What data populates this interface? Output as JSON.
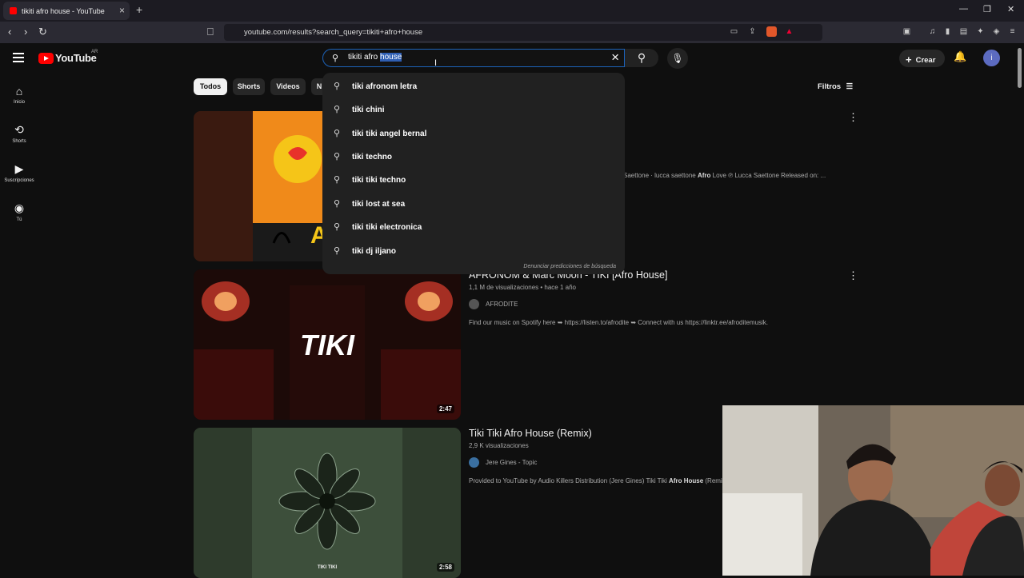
{
  "browser": {
    "tab_title": "tikiti afro house - YouTube",
    "tab_close": "×",
    "new_tab": "+",
    "url": "youtube.com/results?search_query=tikiti+afro+house",
    "win_min": "—",
    "win_max": "❐",
    "win_close": "✕"
  },
  "header": {
    "logo_text": "YouTube",
    "region": "AR",
    "search_query_plain": "tikiti afro ",
    "search_query_selected": "house",
    "create_label": "Crear",
    "avatar_letter": "i"
  },
  "sidebar": {
    "items": [
      {
        "label": "Inicio",
        "icon": "home-icon"
      },
      {
        "label": "Shorts",
        "icon": "shorts-icon"
      },
      {
        "label": "Suscripciones",
        "icon": "subscriptions-icon"
      },
      {
        "label": "Tú",
        "icon": "you-icon"
      }
    ]
  },
  "chips": [
    "Todos",
    "Shorts",
    "Videos",
    "N"
  ],
  "filters_label": "Filtros",
  "suggestions": [
    "tiki afronom letra",
    "tiki chini",
    "tiki tiki angel bernal",
    "tiki techno",
    "tiki tiki techno",
    "tiki lost at sea",
    "tiki tiki electronica",
    "tiki dj iljano"
  ],
  "report_predictions": "Denunciar predicciones de búsqueda",
  "results": [
    {
      "title": "",
      "meta": "",
      "channel": "",
      "desc_pre": "Saettone · lucca saettone ",
      "desc_bold": "Afro",
      "desc_post": " Love ℗ Lucca Saettone Released on: ...",
      "duration": ""
    },
    {
      "title": "AFRONOM & Marc Moon - TIKI [Afro House]",
      "meta": "1,1 M de visualizaciones • hace 1 año",
      "channel": "AFRODITE",
      "desc_pre": "Find our music on Spotify here ➥ https://listen.to/afrodite ➥ Connect with us https://linktr.ee/afroditemusik.",
      "desc_bold": "",
      "desc_post": "",
      "duration": "2:47",
      "thumb_text": "TIKI"
    },
    {
      "title": "Tiki Tiki Afro House (Remix)",
      "meta": "2,9 K visualizaciones",
      "channel": "Jere Gines - Topic",
      "desc_pre": "Provided to YouTube by Audio Killers Distribution (Jere Gines) Tiki Tiki ",
      "desc_bold": "Afro House",
      "desc_post": " (Remix)",
      "duration": "2:58",
      "thumb_caption": "TIKI TIKI"
    }
  ],
  "colors": {
    "background": "#0f0f0f",
    "accent_red": "#ff0000",
    "search_border": "#1c62b9"
  }
}
